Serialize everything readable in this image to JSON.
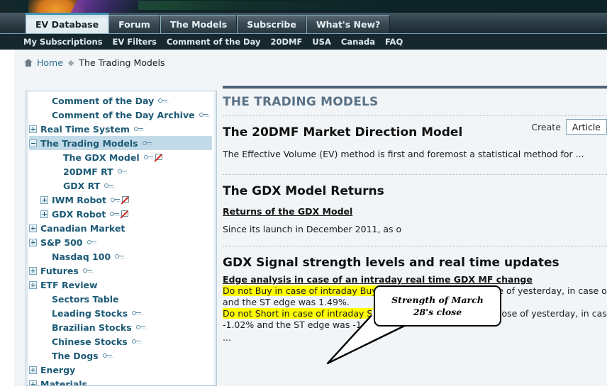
{
  "banner": {
    "name": "site-banner"
  },
  "tabs": [
    {
      "label": "EV Database",
      "active": true
    },
    {
      "label": "Forum",
      "active": false
    },
    {
      "label": "The Models",
      "active": false
    },
    {
      "label": "Subscribe",
      "active": false
    },
    {
      "label": "What's New?",
      "active": false
    }
  ],
  "subnav": [
    "My Subscriptions",
    "EV Filters",
    "Comment of the Day",
    "20DMF",
    "USA",
    "Canada",
    "FAQ"
  ],
  "breadcrumb": {
    "home": "Home",
    "separator": "◆",
    "current": "The Trading Models"
  },
  "create": {
    "label": "Create",
    "selected": "Article"
  },
  "sidebar": {
    "items": [
      {
        "label": "Comment of the Day",
        "expander": "none",
        "key": true,
        "book": false,
        "indent": 1,
        "selected": false
      },
      {
        "label": "Comment of the Day Archive",
        "expander": "none",
        "key": true,
        "book": false,
        "indent": 1,
        "selected": false
      },
      {
        "label": "Real Time System",
        "expander": "plus",
        "key": true,
        "book": false,
        "indent": 0,
        "selected": false
      },
      {
        "label": "The Trading Models",
        "expander": "minus",
        "key": true,
        "book": false,
        "indent": 0,
        "selected": true
      },
      {
        "label": "The GDX Model",
        "expander": "none",
        "key": true,
        "book": true,
        "indent": 2,
        "selected": false
      },
      {
        "label": "20DMF RT",
        "expander": "none",
        "key": true,
        "book": false,
        "indent": 2,
        "selected": false
      },
      {
        "label": "GDX RT",
        "expander": "none",
        "key": true,
        "book": false,
        "indent": 2,
        "selected": false
      },
      {
        "label": "IWM Robot",
        "expander": "plus",
        "key": true,
        "book": true,
        "indent": 1,
        "selected": false
      },
      {
        "label": "GDX Robot",
        "expander": "plus",
        "key": true,
        "book": true,
        "indent": 1,
        "selected": false
      },
      {
        "label": "Canadian Market",
        "expander": "plus",
        "key": false,
        "book": false,
        "indent": 0,
        "selected": false
      },
      {
        "label": "S&P 500",
        "expander": "plus",
        "key": true,
        "book": false,
        "indent": 0,
        "selected": false
      },
      {
        "label": "Nasdaq 100",
        "expander": "none",
        "key": true,
        "book": false,
        "indent": 1,
        "selected": false
      },
      {
        "label": "Futures",
        "expander": "plus",
        "key": true,
        "book": false,
        "indent": 0,
        "selected": false
      },
      {
        "label": "ETF Review",
        "expander": "plus",
        "key": false,
        "book": false,
        "indent": 0,
        "selected": false
      },
      {
        "label": "Sectors Table",
        "expander": "none",
        "key": false,
        "book": false,
        "indent": 1,
        "selected": false
      },
      {
        "label": "Leading Stocks",
        "expander": "none",
        "key": true,
        "book": false,
        "indent": 1,
        "selected": false
      },
      {
        "label": "Brazilian Stocks",
        "expander": "none",
        "key": true,
        "book": false,
        "indent": 1,
        "selected": false
      },
      {
        "label": "Chinese Stocks",
        "expander": "none",
        "key": true,
        "book": false,
        "indent": 1,
        "selected": false
      },
      {
        "label": "The Dogs",
        "expander": "none",
        "key": true,
        "book": false,
        "indent": 1,
        "selected": false
      },
      {
        "label": "Energy",
        "expander": "plus",
        "key": false,
        "book": false,
        "indent": 0,
        "selected": false
      },
      {
        "label": "Materials",
        "expander": "plus",
        "key": false,
        "book": false,
        "indent": 0,
        "selected": false
      }
    ]
  },
  "content": {
    "page_title": "THE TRADING MODELS",
    "section1": {
      "heading": "The 20DMF Market Direction Model",
      "text": "The Effective Volume (EV) method is first and foremost a statistical method for ..."
    },
    "section2": {
      "heading": "The GDX Model Returns",
      "link": "Returns of the GDX Model",
      "text": "Since its launch in December 2011, as o"
    },
    "section3": {
      "heading": "GDX Signal strength levels and real time updates",
      "edge_heading": "Edge analysis in case of an intraday real time GDX MF change",
      "line1_highlight": "Do not Buy in case of intraday Buy signal,",
      "line1_rest": " because at the close of yesterday, in case of a Buy signal",
      "line2": "and the ST edge was 1.49%.",
      "line3_highlight": "Do not Short in case of intraday Short signal,",
      "line3_rest": " because at the close of yesterday, in case of a Short",
      "line4": "-1.02% and the ST edge was -1.82%.",
      "ellipsis": "..."
    }
  },
  "callout": {
    "text": "Strength of March 28's close"
  }
}
